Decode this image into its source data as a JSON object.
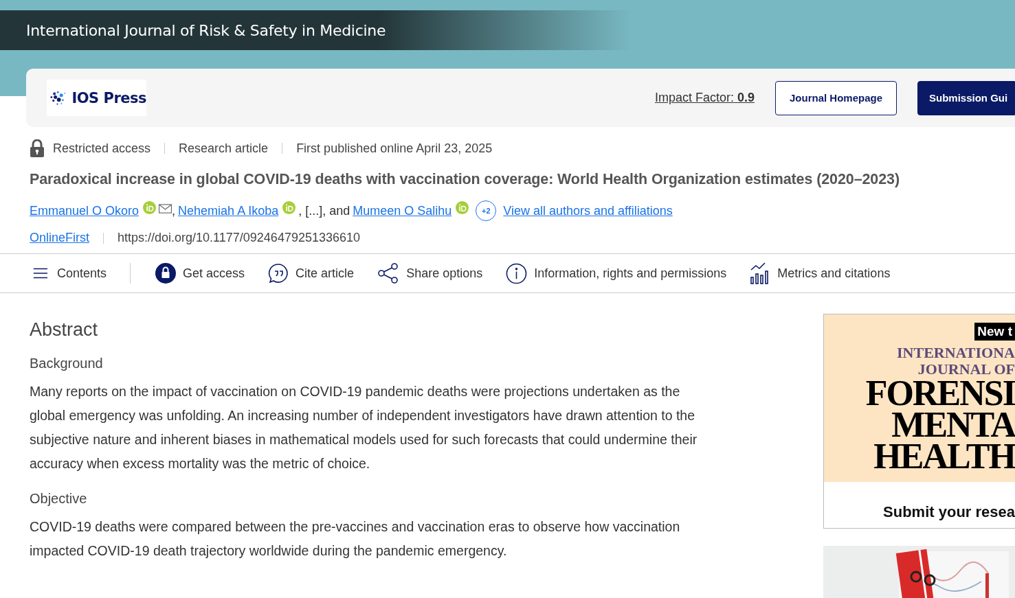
{
  "journal_title": "International Journal of Risk & Safety in Medicine",
  "header": {
    "logo_text": "IOS Press",
    "impact_factor": {
      "label": "Impact Factor:",
      "value": "0.9"
    },
    "buttons": [
      {
        "label": "Journal Homepage",
        "kind": "outline"
      },
      {
        "label": "Submission Gui",
        "kind": "filled"
      }
    ]
  },
  "meta": [
    {
      "text": "Restricted access",
      "kind": "lock"
    },
    {
      "text": "Research article",
      "kind": "plain"
    },
    {
      "text": "First published online April 23, 2025",
      "kind": "plain"
    }
  ],
  "article_title": "Paradoxical increase in global COVID-19 deaths with vaccination coverage: World Health Organization estimates (2020–2023)",
  "authors": [
    {
      "name": "Emmanuel O Okoro",
      "orcid": true,
      "email": true,
      "after": ","
    },
    {
      "name": "Nehemiah A Ikoba",
      "orcid": true,
      "email": false,
      "after": ", [...], and"
    },
    {
      "name": "Mumeen O Salihu",
      "orcid": true,
      "email": false
    }
  ],
  "more_authors": "+2",
  "all_authors_link": "View all authors and affiliations",
  "doi_line": {
    "tag": "OnlineFirst",
    "doi": "https://doi.org/10.1177/09246479251336610"
  },
  "toolbar": [
    {
      "label": "Contents",
      "kind": "menu"
    },
    {
      "label": "Get access",
      "kind": "lock"
    },
    {
      "label": "Cite article",
      "kind": "quote"
    },
    {
      "label": "Share options",
      "kind": "share"
    },
    {
      "label": "Information, rights and permissions",
      "kind": "info"
    },
    {
      "label": "Metrics and citations",
      "kind": "metrics"
    }
  ],
  "abstract": {
    "heading": "Abstract",
    "sections": [
      {
        "heading": "Background",
        "text": "Many reports on the impact of vaccination on COVID-19 pandemic deaths were projections undertaken as the global emergency was unfolding. An increasing number of independent investigators have drawn attention to the subjective nature and inherent biases in mathematical models used for such forecasts that could undermine their accuracy when excess mortality was the metric of choice."
      },
      {
        "heading": "Objective",
        "text": "COVID-19 deaths were compared between the pre-vaccines and vaccination eras to observe how vaccination impacted COVID-19 death trajectory worldwide during the pandemic emergency."
      }
    ]
  },
  "ads": [
    {
      "kind": "banner",
      "tag": "New t",
      "lines": [
        "INTERNATIONA",
        "JOURNAL OF"
      ],
      "big_lines": [
        "FORENSI",
        "MENTA",
        "HEALTH"
      ],
      "cta": "Submit your resea"
    },
    {
      "kind": "picture"
    }
  ]
}
